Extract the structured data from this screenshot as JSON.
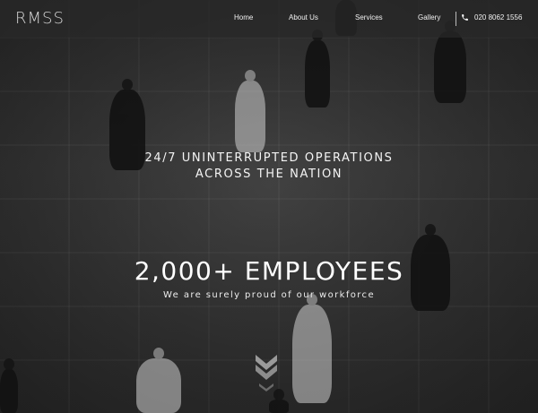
{
  "brand": {
    "logo": "RMSS"
  },
  "nav": {
    "items": [
      {
        "label": "Home"
      },
      {
        "label": "About Us"
      },
      {
        "label": "Services"
      },
      {
        "label": "Gallery"
      }
    ],
    "phone_icon": "phone-icon",
    "phone": "020 8062 1556"
  },
  "hero": {
    "tagline_line1": "24/7 UNINTERRUPTED OPERATIONS",
    "tagline_line2": "ACROSS THE NATION",
    "headline": "2,000+ EMPLOYEES",
    "subline": "We are surely proud of our workforce",
    "scroll_icon": "chevron-double-down-icon"
  },
  "colors": {
    "header_bg": "#2a2a2a",
    "text": "#ffffff",
    "chevron": "#9a9a9a"
  }
}
